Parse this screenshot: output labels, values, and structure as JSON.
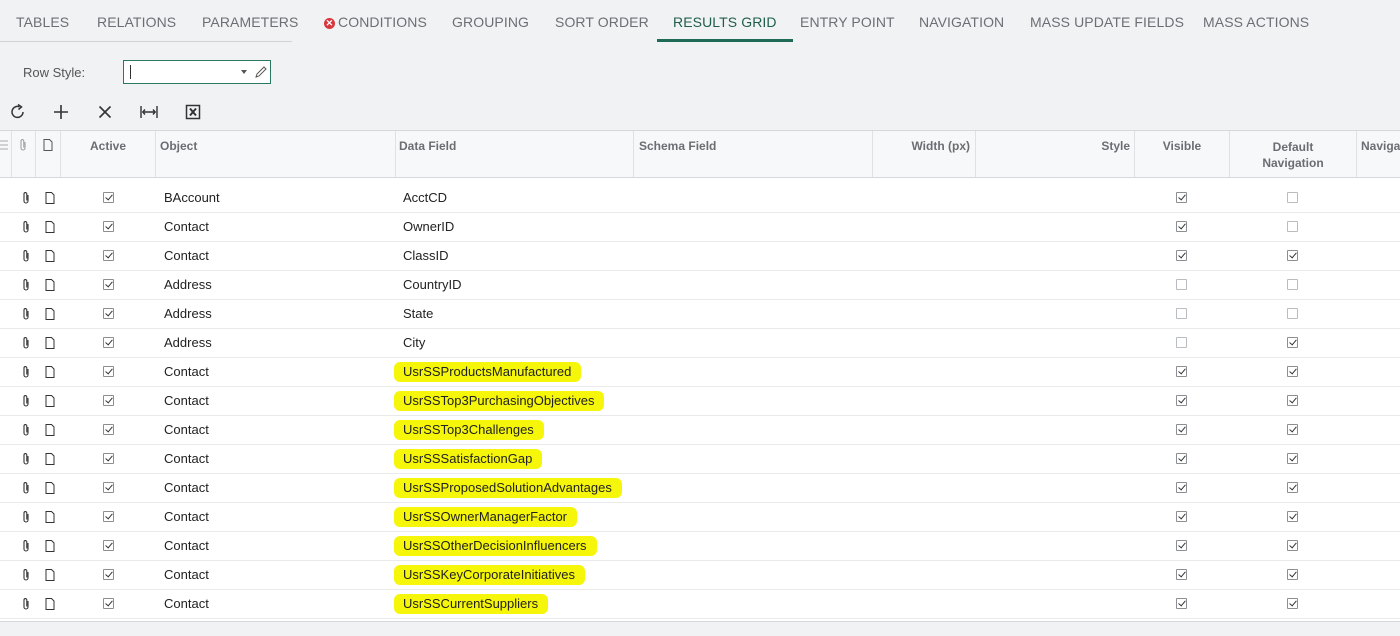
{
  "tabs": [
    {
      "label": "TABLES"
    },
    {
      "label": "RELATIONS"
    },
    {
      "label": "PARAMETERS"
    },
    {
      "label": "CONDITIONS",
      "icon": "error-icon"
    },
    {
      "label": "GROUPING"
    },
    {
      "label": "SORT ORDER"
    },
    {
      "label": "RESULTS GRID",
      "active": true
    },
    {
      "label": "ENTRY POINT"
    },
    {
      "label": "NAVIGATION"
    },
    {
      "label": "MASS UPDATE FIELDS"
    },
    {
      "label": "MASS ACTIONS"
    }
  ],
  "row_style": {
    "label": "Row Style:",
    "value": ""
  },
  "toolbar": {
    "icons": [
      "refresh-icon",
      "add-icon",
      "delete-icon",
      "fit-columns-icon",
      "export-excel-icon"
    ]
  },
  "grid": {
    "columns": {
      "active": "Active",
      "object": "Object",
      "data_field": "Data Field",
      "schema_field": "Schema Field",
      "width": "Width (px)",
      "style": "Style",
      "visible": "Visible",
      "default_nav_1": "Default",
      "default_nav_2": "Navigation",
      "navigation": "Naviga"
    },
    "rows": [
      {
        "active": true,
        "object": "BAccount",
        "data_field": "AcctCD",
        "visible": true,
        "default_nav": false,
        "highlight": false
      },
      {
        "active": true,
        "object": "Contact",
        "data_field": "OwnerID",
        "visible": true,
        "default_nav": false,
        "highlight": false
      },
      {
        "active": true,
        "object": "Contact",
        "data_field": "ClassID",
        "visible": true,
        "default_nav": true,
        "highlight": false
      },
      {
        "active": true,
        "object": "Address",
        "data_field": "CountryID",
        "visible": false,
        "default_nav": false,
        "highlight": false
      },
      {
        "active": true,
        "object": "Address",
        "data_field": "State",
        "visible": false,
        "default_nav": false,
        "highlight": false
      },
      {
        "active": true,
        "object": "Address",
        "data_field": "City",
        "visible": false,
        "default_nav": true,
        "highlight": false
      },
      {
        "active": true,
        "object": "Contact",
        "data_field": "UsrSSProductsManufactured",
        "visible": true,
        "default_nav": true,
        "highlight": true
      },
      {
        "active": true,
        "object": "Contact",
        "data_field": "UsrSSTop3PurchasingObjectives",
        "visible": true,
        "default_nav": true,
        "highlight": true
      },
      {
        "active": true,
        "object": "Contact",
        "data_field": "UsrSSTop3Challenges",
        "visible": true,
        "default_nav": true,
        "highlight": true
      },
      {
        "active": true,
        "object": "Contact",
        "data_field": "UsrSSSatisfactionGap",
        "visible": true,
        "default_nav": true,
        "highlight": true
      },
      {
        "active": true,
        "object": "Contact",
        "data_field": "UsrSSProposedSolutionAdvantages",
        "visible": true,
        "default_nav": true,
        "highlight": true
      },
      {
        "active": true,
        "object": "Contact",
        "data_field": "UsrSSOwnerManagerFactor",
        "visible": true,
        "default_nav": true,
        "highlight": true
      },
      {
        "active": true,
        "object": "Contact",
        "data_field": "UsrSSOtherDecisionInfluencers",
        "visible": true,
        "default_nav": true,
        "highlight": true
      },
      {
        "active": true,
        "object": "Contact",
        "data_field": "UsrSSKeyCorporateInitiatives",
        "visible": true,
        "default_nav": true,
        "highlight": true
      },
      {
        "active": true,
        "object": "Contact",
        "data_field": "UsrSSCurrentSuppliers",
        "visible": true,
        "default_nav": true,
        "highlight": true
      }
    ]
  },
  "colors": {
    "accent": "#1f6b57",
    "highlight": "#f6f60b",
    "error": "#d9363e"
  }
}
